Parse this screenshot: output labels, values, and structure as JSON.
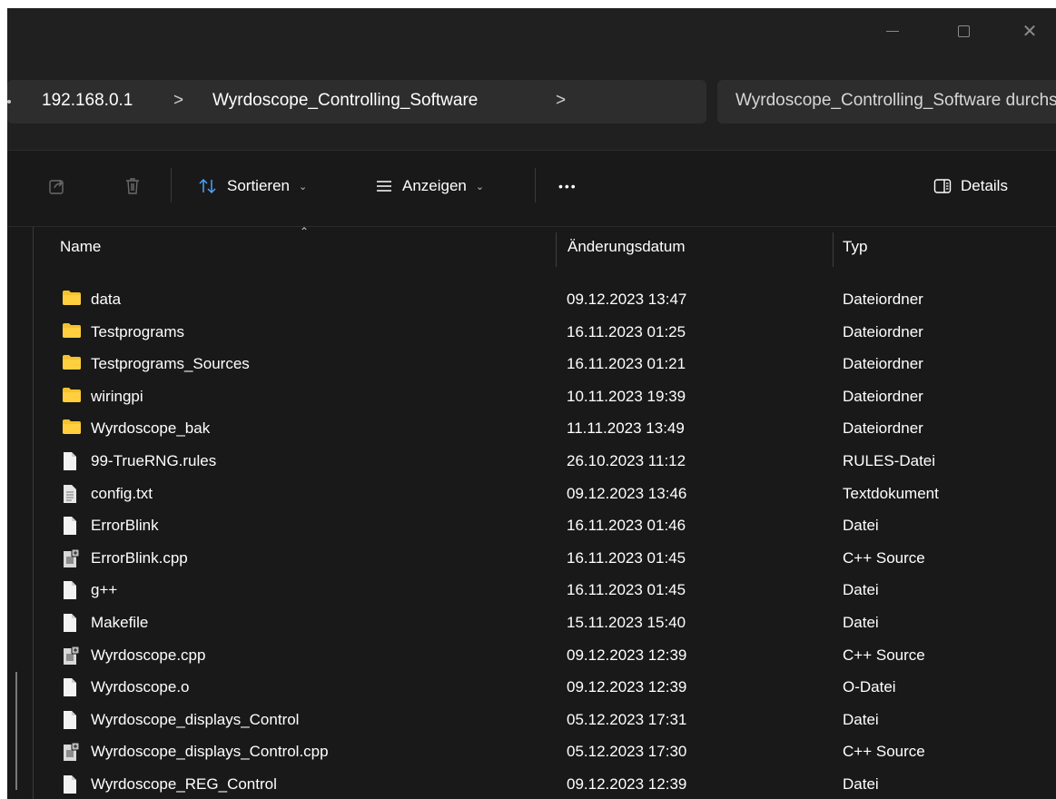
{
  "window": {
    "controls": {
      "minimize": "—",
      "maximize": "□",
      "close": "✕"
    }
  },
  "address": {
    "breadcrumbs": [
      "192.168.0.1",
      "Wyrdoscope_Controlling_Software"
    ],
    "separator": ">",
    "search_placeholder": "Wyrdoscope_Controlling_Software durchsuchen"
  },
  "toolbar": {
    "sort_label": "Sortieren",
    "view_label": "Anzeigen",
    "more_label": "•••",
    "details_label": "Details"
  },
  "columns": {
    "name": "Name",
    "date": "Änderungsdatum",
    "type": "Typ"
  },
  "files": [
    {
      "name": "data",
      "date": "09.12.2023 13:47",
      "type": "Dateiordner",
      "icon": "folder-icon"
    },
    {
      "name": "Testprograms",
      "date": "16.11.2023 01:25",
      "type": "Dateiordner",
      "icon": "folder-icon"
    },
    {
      "name": "Testprograms_Sources",
      "date": "16.11.2023 01:21",
      "type": "Dateiordner",
      "icon": "folder-icon"
    },
    {
      "name": "wiringpi",
      "date": "10.11.2023 19:39",
      "type": "Dateiordner",
      "icon": "folder-icon"
    },
    {
      "name": "Wyrdoscope_bak",
      "date": "11.11.2023 13:49",
      "type": "Dateiordner",
      "icon": "folder-icon"
    },
    {
      "name": "99-TrueRNG.rules",
      "date": "26.10.2023 11:12",
      "type": "RULES-Datei",
      "icon": "file-icon"
    },
    {
      "name": "config.txt",
      "date": "09.12.2023 13:46",
      "type": "Textdokument",
      "icon": "text-file-icon"
    },
    {
      "name": "ErrorBlink",
      "date": "16.11.2023 01:46",
      "type": "Datei",
      "icon": "file-icon"
    },
    {
      "name": "ErrorBlink.cpp",
      "date": "16.11.2023 01:45",
      "type": "C++ Source",
      "icon": "cpp-file-icon"
    },
    {
      "name": "g++",
      "date": "16.11.2023 01:45",
      "type": "Datei",
      "icon": "file-icon"
    },
    {
      "name": "Makefile",
      "date": "15.11.2023 15:40",
      "type": "Datei",
      "icon": "file-icon"
    },
    {
      "name": "Wyrdoscope.cpp",
      "date": "09.12.2023 12:39",
      "type": "C++ Source",
      "icon": "cpp-file-icon"
    },
    {
      "name": "Wyrdoscope.o",
      "date": "09.12.2023 12:39",
      "type": "O-Datei",
      "icon": "file-icon"
    },
    {
      "name": "Wyrdoscope_displays_Control",
      "date": "05.12.2023 17:31",
      "type": "Datei",
      "icon": "file-icon"
    },
    {
      "name": "Wyrdoscope_displays_Control.cpp",
      "date": "05.12.2023 17:30",
      "type": "C++ Source",
      "icon": "cpp-file-icon"
    },
    {
      "name": "Wyrdoscope_REG_Control",
      "date": "09.12.2023 12:39",
      "type": "Datei",
      "icon": "file-icon"
    }
  ],
  "colors": {
    "background": "#191919",
    "chrome": "#202020",
    "folder": "#f4c22c",
    "file": "#f2f2f2"
  }
}
